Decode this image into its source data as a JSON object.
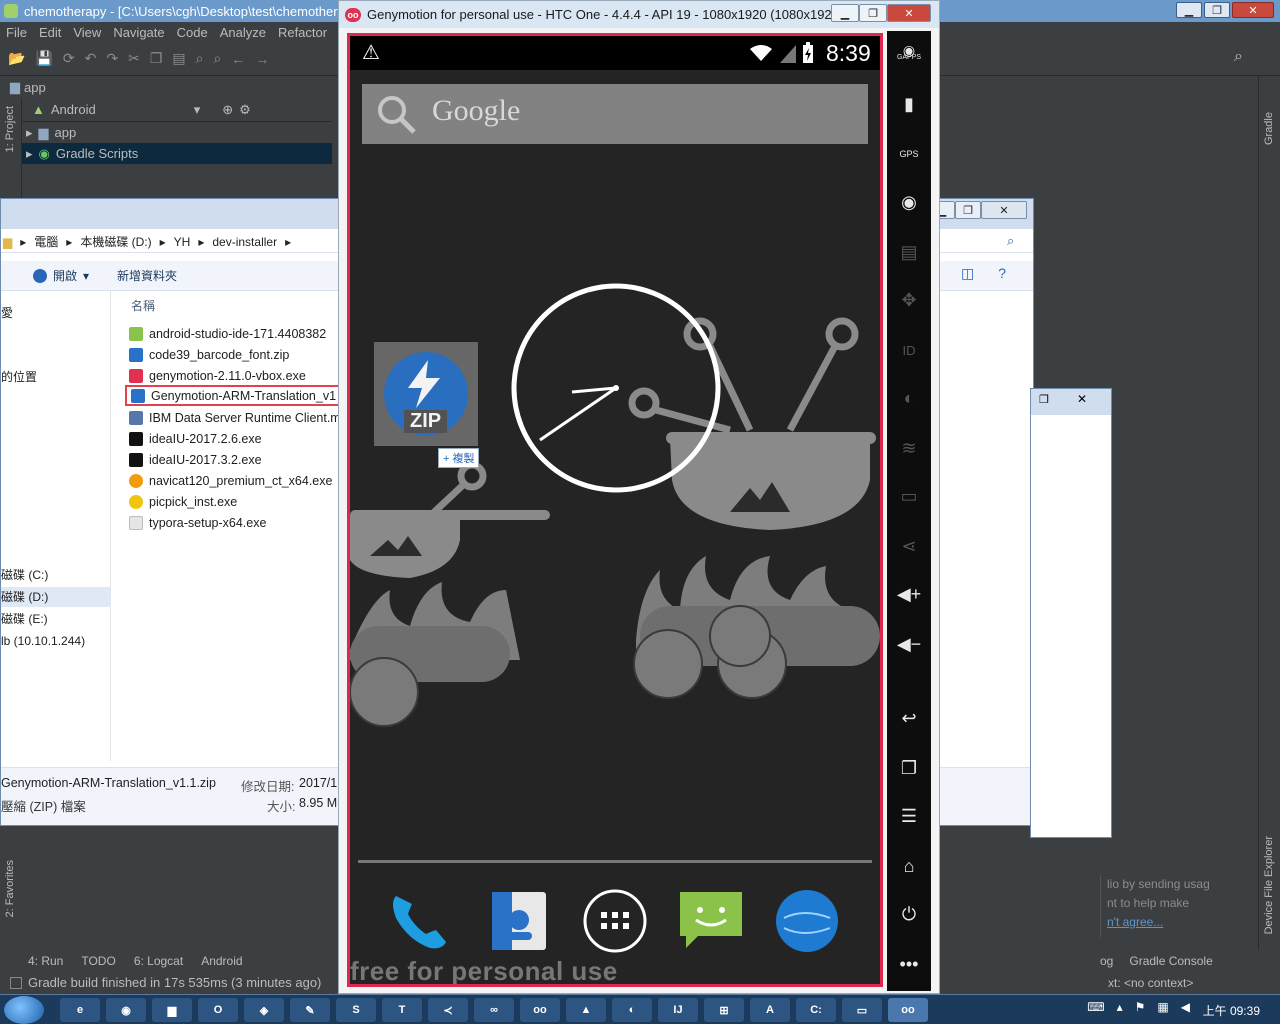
{
  "android_studio": {
    "title": "chemotherapy - [C:\\Users\\cgh\\Desktop\\test\\chemother",
    "menu": [
      "File",
      "Edit",
      "View",
      "Navigate",
      "Code",
      "Analyze",
      "Refactor"
    ],
    "breadcrumb": "app",
    "project_view": "Android",
    "tree": [
      {
        "label": "app",
        "icon": "folder-icon"
      },
      {
        "label": "Gradle Scripts",
        "icon": "gradle-icon"
      }
    ],
    "left_tabs": [
      "1: Project",
      "2: Favorites"
    ],
    "right_tabs": [
      "Gradle",
      "Device File Explorer"
    ],
    "bottom_tabs": [
      "4: Run",
      "TODO",
      "6: Logcat",
      "Android"
    ],
    "bottom_tabs_right": [
      "og",
      "Gradle Console"
    ],
    "status": "Gradle build finished in 17s 535ms (3 minutes ago)",
    "context": "xt: <no context>",
    "notification": {
      "line1": "lio by sending usag",
      "line2": "nt to help make",
      "link": "n't agree..."
    }
  },
  "explorer": {
    "path": [
      "電腦",
      "本機磁碟 (D:)",
      "YH",
      "dev-installer"
    ],
    "organize": "開啟",
    "new_folder": "新增資料夾",
    "column_name": "名稱",
    "nav": [
      {
        "label": "愛",
        "selected": false
      },
      {
        "label": "的位置",
        "selected": false
      },
      {
        "label": "磁碟 (C:)",
        "selected": false
      },
      {
        "label": "磁碟 (D:)",
        "selected": true
      },
      {
        "label": "磁碟 (E:)",
        "selected": false
      },
      {
        "label": "lb (10.10.1.244)",
        "selected": false
      }
    ],
    "files": [
      {
        "name": "android-studio-ide-171.4408382",
        "icon": "android-installer-icon",
        "color": "#8bc34a"
      },
      {
        "name": "code39_barcode_font.zip",
        "icon": "zip-icon",
        "color": "#2a72c8"
      },
      {
        "name": "genymotion-2.11.0-vbox.exe",
        "icon": "exe-icon",
        "color": "#e0314e"
      },
      {
        "name": "Genymotion-ARM-Translation_v1",
        "icon": "zip-icon",
        "color": "#2a72c8",
        "boxed": true
      },
      {
        "name": "IBM Data Server Runtime Client.m",
        "icon": "msi-icon",
        "color": "#5577aa"
      },
      {
        "name": "ideaIU-2017.2.6.exe",
        "icon": "intellij-icon",
        "color": "#111111"
      },
      {
        "name": "ideaIU-2017.3.2.exe",
        "icon": "intellij-icon",
        "color": "#111111"
      },
      {
        "name": "navicat120_premium_ct_x64.exe",
        "icon": "navicat-icon",
        "color": "#f39c12"
      },
      {
        "name": "picpick_inst.exe",
        "icon": "picpick-icon",
        "color": "#f1c40f"
      },
      {
        "name": "typora-setup-x64.exe",
        "icon": "typora-icon",
        "color": "#bbbbbb"
      }
    ],
    "details": {
      "filename": "Genymotion-ARM-Translation_v1.1.zip",
      "type": "壓縮 (ZIP) 檔案",
      "modified_label": "修改日期:",
      "modified_value": "2017/1",
      "size_label": "大小:",
      "size_value": "8.95 M"
    }
  },
  "genymotion": {
    "title": "Genymotion for personal use - HTC One - 4.4.4 - API 19 - 1080x1920 (1080x192...",
    "logo": "oo",
    "clock": "8:39",
    "search_text": "Google",
    "drag_label": "ZIP",
    "copy_badge": "+ 複製",
    "watermark": "free for personal use",
    "side_buttons": [
      "GAPPS",
      "battery",
      "GPS",
      "camera",
      "media",
      "move",
      "ID",
      "disk",
      "cast",
      "sms",
      "share",
      "volume-up",
      "volume-down",
      "back",
      "recent-apps",
      "menu",
      "home",
      "power",
      "more"
    ],
    "dock": [
      "phone",
      "contacts",
      "app-drawer",
      "messaging",
      "browser"
    ]
  },
  "taskbar": {
    "clock": "上午 09:39",
    "apps": [
      "ie",
      "chrome",
      "explorer",
      "office",
      "network",
      "notepad",
      "sublime",
      "text",
      "vscode",
      "visual-studio",
      "genymotion",
      "android",
      "picpick",
      "intellij",
      "remote",
      "adobe",
      "cmd",
      "terminal",
      "genymotion-active"
    ]
  },
  "colors": {
    "genymotion_frame": "#e0284f",
    "as_bg": "#3c3f41",
    "explorer_sel": "#dfe9f5"
  }
}
